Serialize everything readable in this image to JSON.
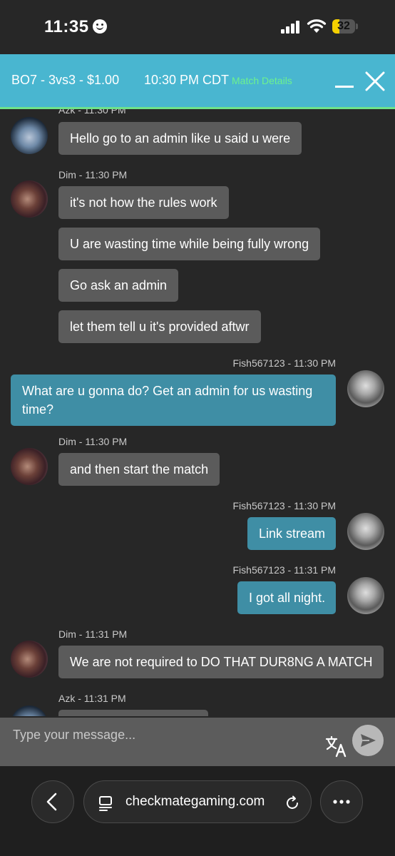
{
  "status_bar": {
    "time": "11:35",
    "battery": "32",
    "battery_level": 0.32
  },
  "header": {
    "title": "BO7 - 3vs3 - $1.00",
    "time": "10:30 PM CDT",
    "details_link": "Match Details"
  },
  "messages": [
    {
      "meta": "Azk - 11:30 PM",
      "text": "Hello go to an admin like u said u were"
    },
    {
      "meta": "Dim - 11:30 PM",
      "text": "it's not how the rules work"
    },
    {
      "text": "U are wasting time while being fully wrong"
    },
    {
      "text": "Go ask an admin"
    },
    {
      "text": "let them tell u it's provided aftwr"
    },
    {
      "meta": "Fish567123 - 11:30 PM",
      "text": "What are u gonna do? Get an admin for us wasting time?"
    },
    {
      "meta": "Dim - 11:30 PM",
      "text": "and then start the match"
    },
    {
      "meta": "Fish567123 - 11:30 PM",
      "text": "Link stream"
    },
    {
      "meta": "Fish567123 - 11:31 PM",
      "text": "I got all night."
    },
    {
      "meta": "Dim - 11:31 PM",
      "text": "We are not required to DO THAT DUR8NG A MATCH"
    },
    {
      "meta": "Azk - 11:31 PM",
      "text": ""
    }
  ],
  "composer": {
    "placeholder": "Type your message..."
  },
  "browser": {
    "url": "checkmategaming.com"
  },
  "colors": {
    "header": "#49b6d0",
    "header_accent": "#6ee38a",
    "my_bubble": "#3f8ea5",
    "their_bubble": "#5b5b5b",
    "background": "#272727"
  }
}
